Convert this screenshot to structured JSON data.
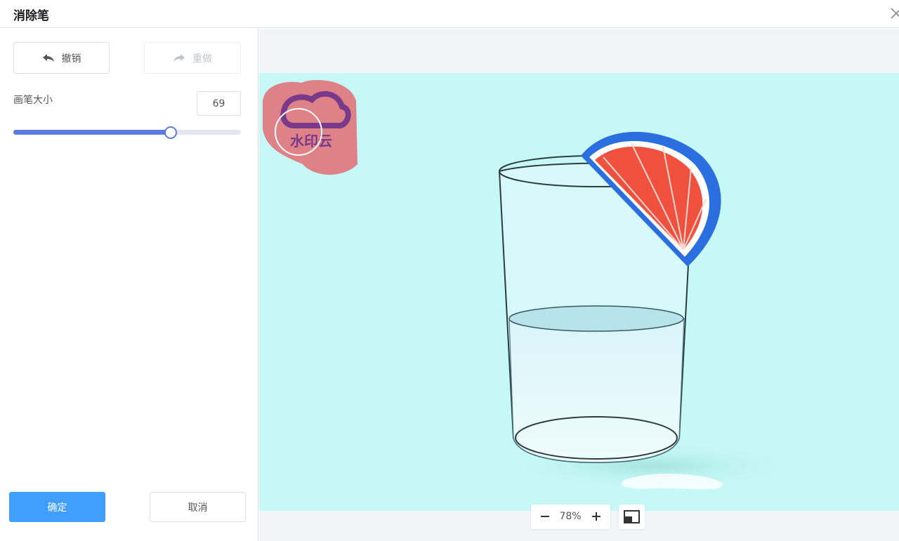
{
  "dialog": {
    "title": "消除笔"
  },
  "toolbar": {
    "undo_label": "撤销",
    "redo_label": "重做"
  },
  "brush": {
    "label": "画笔大小",
    "size_value": "69",
    "slider_percent": 69
  },
  "footer": {
    "confirm_label": "确定",
    "cancel_label": "取消"
  },
  "watermark": {
    "text": "水印云"
  },
  "zoom": {
    "level": "78%"
  },
  "colors": {
    "accent": "#409eff",
    "slider": "#5b7be0",
    "image_background": "#c6f8f7",
    "mask": "#e0747a",
    "canvas_background": "#f3f4f7"
  },
  "icons": [
    "close-icon",
    "undo-arrow-icon",
    "redo-arrow-icon",
    "zoom-out-icon",
    "zoom-in-icon",
    "fit-screen-icon"
  ]
}
